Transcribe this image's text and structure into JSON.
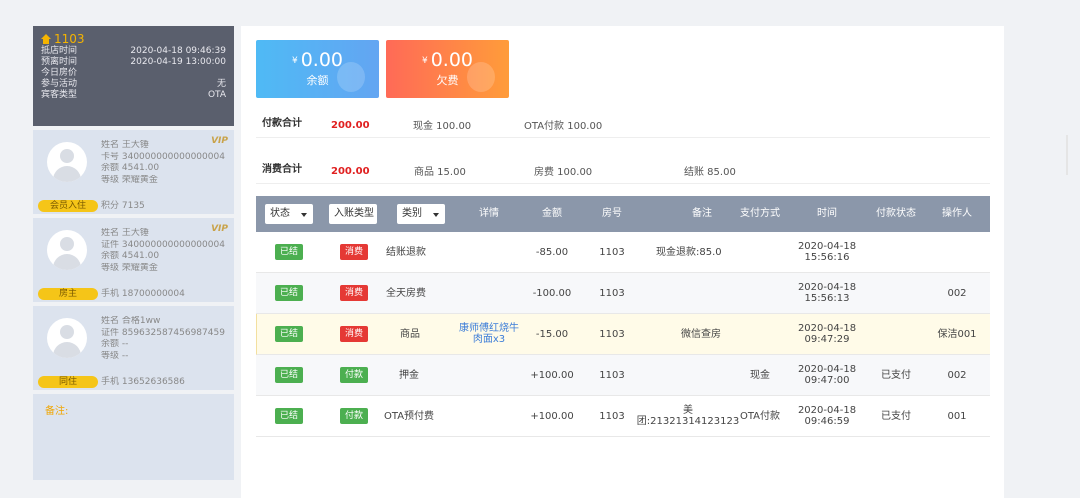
{
  "room": {
    "number": "1103",
    "rows": [
      {
        "label": "抵店时间",
        "value": "2020-04-18 09:46:39"
      },
      {
        "label": "预离时间",
        "value": "2020-04-19 13:00:00"
      },
      {
        "label": "今日房价",
        "value": ""
      },
      {
        "label": "参与活动",
        "value": "无"
      },
      {
        "label": "宾客类型",
        "value": "OTA"
      }
    ]
  },
  "guests": [
    {
      "lines": [
        "姓名 王大锤",
        "卡号 340000000000000004",
        "余额 4541.00",
        "等级 荣耀黄金"
      ],
      "vip": "VIP",
      "tag": "会员入住",
      "tag_after": "积分 7135"
    },
    {
      "lines": [
        "姓名 王大锤",
        "证件 340000000000000004",
        "余额 4541.00",
        "等级 荣耀黄金"
      ],
      "vip": "VIP",
      "tag": "房主",
      "tag_after": "手机 18700000004"
    },
    {
      "lines": [
        "姓名 合格1ww",
        "证件 859632587456987459",
        "余额 --",
        "等级 --"
      ],
      "vip": "",
      "tag": "同住",
      "tag_after": "手机 13652636586"
    }
  ],
  "remark_label": "备注:",
  "stats": {
    "balance": {
      "currency": "¥",
      "amount": "0.00",
      "label": "余额"
    },
    "owed": {
      "currency": "¥",
      "amount": "0.00",
      "label": "欠费"
    }
  },
  "payment_summary": {
    "title": "付款合计",
    "total": "200.00",
    "items": [
      "现金 100.00",
      "OTA付款 100.00"
    ]
  },
  "consumption_summary": {
    "title": "消费合计",
    "total": "200.00",
    "items": [
      "商品 15.00",
      "房费 100.00",
      "结账 85.00"
    ]
  },
  "table": {
    "filters": {
      "status": "状态",
      "entry_type": "入账类型",
      "category": "类别"
    },
    "headers": {
      "detail": "详情",
      "amount": "金额",
      "room": "房号",
      "note": "备注",
      "pay_method": "支付方式",
      "time": "时间",
      "pay_status": "付款状态",
      "operator": "操作人"
    },
    "rows": [
      {
        "status": "已结",
        "type": "消费",
        "category": "结账退款",
        "detail": "",
        "amount": "-85.00",
        "room": "1103",
        "note": "现金退款:85.0",
        "pay_method": "",
        "date": "2020-04-18",
        "time": "15:56:16",
        "pay_status": "",
        "operator": ""
      },
      {
        "status": "已结",
        "type": "消费",
        "category": "全天房费",
        "detail": "",
        "amount": "-100.00",
        "room": "1103",
        "note": "",
        "pay_method": "",
        "date": "2020-04-18",
        "time": "15:56:13",
        "pay_status": "",
        "operator": "002"
      },
      {
        "status": "已结",
        "type": "消费",
        "category": "商品",
        "detail_l1": "康师傅红烧牛",
        "detail_l2": "肉面x3",
        "amount": "-15.00",
        "room": "1103",
        "note": "微信查房",
        "pay_method": "",
        "date": "2020-04-18",
        "time": "09:47:29",
        "pay_status": "",
        "operator": "保洁001"
      },
      {
        "status": "已结",
        "type": "付款",
        "category": "押金",
        "detail": "",
        "amount": "+100.00",
        "room": "1103",
        "note": "",
        "pay_method": "现金",
        "date": "2020-04-18",
        "time": "09:47:00",
        "pay_status": "已支付",
        "operator": "002"
      },
      {
        "status": "已结",
        "type": "付款",
        "category": "OTA预付费",
        "detail": "",
        "amount": "+100.00",
        "room": "1103",
        "note_l1": "美",
        "note_l2": "团:21321314123123",
        "pay_method": "OTA付款",
        "date": "2020-04-18",
        "time": "09:46:59",
        "pay_status": "已支付",
        "operator": "001"
      }
    ]
  },
  "colors": {
    "consume_badge": "#e53935",
    "pay_badge": "#4caf50",
    "settled_badge": "#4caf50",
    "sum_total": "#e02020",
    "header_bg": "#8b97aa"
  }
}
